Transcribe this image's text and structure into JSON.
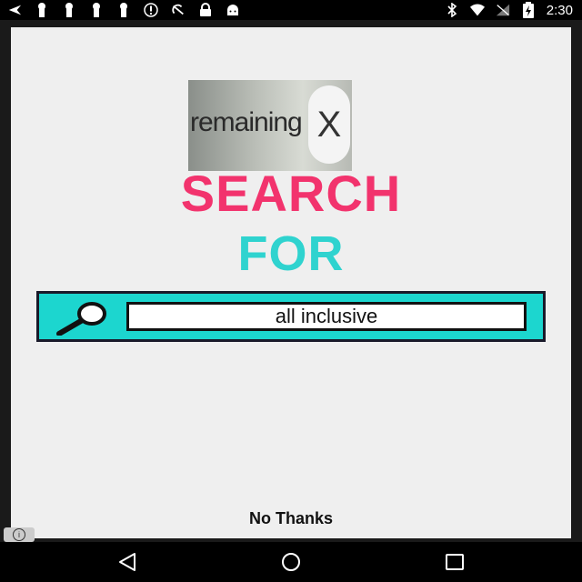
{
  "status_bar": {
    "time": "2:30",
    "left_icons": [
      "back-arrow-icon",
      "keyhole-icon",
      "keyhole-icon",
      "keyhole-icon",
      "keyhole-icon",
      "alert-circle-icon",
      "no-sync-icon",
      "lock-icon",
      "android-icon"
    ],
    "right_icons": [
      "bluetooth-icon",
      "wifi-icon",
      "no-signal-icon",
      "battery-charging-icon"
    ]
  },
  "ad": {
    "thumb_text": "remaining",
    "thumb_close_glyph": "X",
    "headline_primary": "SEARCH",
    "headline_secondary": "FOR",
    "search_query": "all inclusive",
    "dismiss_label": "No Thanks",
    "colors": {
      "headline_primary": "#f2336d",
      "headline_secondary": "#2fd3cf",
      "search_box_bg": "#1cd6cf",
      "panel_bg": "#efefef"
    }
  },
  "nav_bar": {
    "icons": [
      "back-triangle-icon",
      "home-circle-icon",
      "recents-square-icon"
    ]
  }
}
